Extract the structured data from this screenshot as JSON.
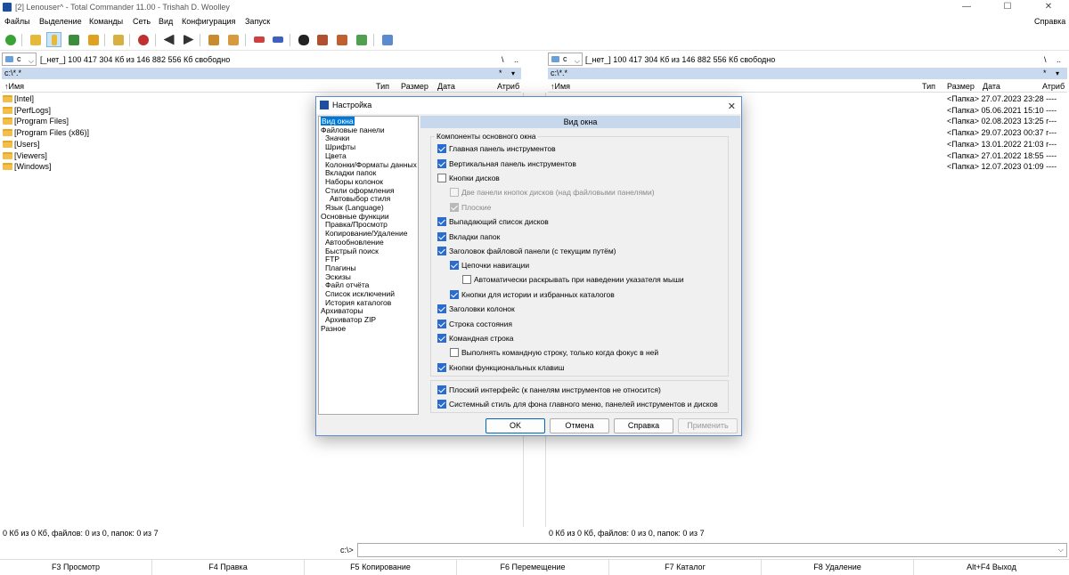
{
  "window": {
    "title": "[2] Lenouser^ - Total Commander 11.00 - Trishah D. Woolley",
    "minimize": "—",
    "maximize": "☐",
    "close": "✕"
  },
  "menu": {
    "items": [
      "Файлы",
      "Выделение",
      "Команды",
      "Сеть",
      "Вид",
      "Конфигурация",
      "Запуск"
    ],
    "help": "Справка"
  },
  "left_panel": {
    "drive": "c",
    "drive_info": "[_нет_]  100 417 304 Кб из 146 882 556 Кб свободно",
    "root_btn": "\\",
    "up_btn": "..",
    "path": "c:\\*.*",
    "path_star": "*",
    "columns": {
      "name": "↑Имя",
      "type": "Тип",
      "size": "Размер",
      "date": "Дата",
      "attr": "Атриб"
    },
    "files": [
      "[Intel]",
      "[PerfLogs]",
      "[Program Files]",
      "[Program Files (x86)]",
      "[Users]",
      "[Viewers]",
      "[Windows]"
    ],
    "status": "0 Кб из 0 Кб, файлов: 0 из 0, папок: 0 из 7"
  },
  "right_panel": {
    "drive": "c",
    "drive_info": "[_нет_]  100 417 304 Кб из 146 882 556 Кб свободно",
    "root_btn": "\\",
    "up_btn": "..",
    "path": "c:\\*.*",
    "path_star": "*",
    "columns": {
      "name": "↑Имя",
      "type": "Тип",
      "size": "Размер",
      "date": "Дата",
      "attr": "Атриб"
    },
    "rows": [
      {
        "size": "<Папка>",
        "date": "27.07.2023 23:28",
        "attr": "----"
      },
      {
        "size": "<Папка>",
        "date": "05.06.2021 15:10",
        "attr": "----"
      },
      {
        "size": "<Папка>",
        "date": "02.08.2023 13:25",
        "attr": "r---"
      },
      {
        "size": "<Папка>",
        "date": "29.07.2023 00:37",
        "attr": "r---"
      },
      {
        "size": "<Папка>",
        "date": "13.01.2022 21:03",
        "attr": "r---"
      },
      {
        "size": "<Папка>",
        "date": "27.01.2022 18:55",
        "attr": "----"
      },
      {
        "size": "<Папка>",
        "date": "12.07.2023 01:09",
        "attr": "----"
      }
    ],
    "status": "0 Кб из 0 Кб, файлов: 0 из 0, папок: 0 из 7"
  },
  "cmdline": {
    "prompt": "c:\\>"
  },
  "fkeys": [
    "F3 Просмотр",
    "F4 Правка",
    "F5 Копирование",
    "F6 Перемещение",
    "F7 Каталог",
    "F8 Удаление",
    "Alt+F4 Выход"
  ],
  "dialog": {
    "title": "Настройка",
    "close": "✕",
    "page_header": "Вид окна",
    "tree": [
      {
        "label": "Вид окна",
        "level": 0,
        "selected": true
      },
      {
        "label": "Файловые панели",
        "level": 0
      },
      {
        "label": "Значки",
        "level": 1
      },
      {
        "label": "Шрифты",
        "level": 1
      },
      {
        "label": "Цвета",
        "level": 1
      },
      {
        "label": "Колонки/Форматы данных",
        "level": 1
      },
      {
        "label": "Вкладки папок",
        "level": 1
      },
      {
        "label": "Наборы колонок",
        "level": 1
      },
      {
        "label": "Стили оформления",
        "level": 1
      },
      {
        "label": "Автовыбор стиля",
        "level": 2
      },
      {
        "label": "Язык (Language)",
        "level": 1
      },
      {
        "label": "Основные функции",
        "level": 0
      },
      {
        "label": "Правка/Просмотр",
        "level": 1
      },
      {
        "label": "Копирование/Удаление",
        "level": 1
      },
      {
        "label": "Автообновление",
        "level": 1
      },
      {
        "label": "Быстрый поиск",
        "level": 1
      },
      {
        "label": "FTP",
        "level": 1
      },
      {
        "label": "Плагины",
        "level": 1
      },
      {
        "label": "Эскизы",
        "level": 1
      },
      {
        "label": "Файл отчёта",
        "level": 1
      },
      {
        "label": "Список исключений",
        "level": 1
      },
      {
        "label": "История каталогов",
        "level": 1
      },
      {
        "label": "Архиваторы",
        "level": 0
      },
      {
        "label": "Архиватор ZIP",
        "level": 1
      },
      {
        "label": "Разное",
        "level": 0
      }
    ],
    "group_title": "Компоненты основного окна",
    "options": [
      {
        "label": "Главная панель инструментов",
        "checked": true,
        "indent": 0,
        "disabled": false
      },
      {
        "label": "Вертикальная панель инструментов",
        "checked": true,
        "indent": 0,
        "disabled": false
      },
      {
        "label": "Кнопки дисков",
        "checked": false,
        "indent": 0,
        "disabled": false
      },
      {
        "label": "Две панели кнопок дисков (над файловыми панелями)",
        "checked": false,
        "indent": 1,
        "disabled": true
      },
      {
        "label": "Плоские",
        "checked": true,
        "indent": 1,
        "disabled": true
      },
      {
        "label": "Выпадающий список дисков",
        "checked": true,
        "indent": 0,
        "disabled": false
      },
      {
        "label": "Вкладки папок",
        "checked": true,
        "indent": 0,
        "disabled": false
      },
      {
        "label": "Заголовок файловой панели (с текущим путём)",
        "checked": true,
        "indent": 0,
        "disabled": false
      },
      {
        "label": "Цепочки навигации",
        "checked": true,
        "indent": 1,
        "disabled": false
      },
      {
        "label": "Автоматически раскрывать при наведении указателя мыши",
        "checked": false,
        "indent": 2,
        "disabled": false
      },
      {
        "label": "Кнопки для истории и избранных каталогов",
        "checked": true,
        "indent": 1,
        "disabled": false
      },
      {
        "label": "Заголовки колонок",
        "checked": true,
        "indent": 0,
        "disabled": false
      },
      {
        "label": "Строка состояния",
        "checked": true,
        "indent": 0,
        "disabled": false
      },
      {
        "label": "Командная строка",
        "checked": true,
        "indent": 0,
        "disabled": false
      },
      {
        "label": "Выполнять командную строку, только когда фокус в ней",
        "checked": false,
        "indent": 1,
        "disabled": false
      },
      {
        "label": "Кнопки функциональных клавиш",
        "checked": true,
        "indent": 0,
        "disabled": false
      }
    ],
    "extra_options": [
      {
        "label": "Плоский интерфейс (к панелям инструментов не относится)",
        "checked": true
      },
      {
        "label": "Системный стиль для фона главного меню, панелей инструментов и дисков",
        "checked": true
      }
    ],
    "buttons": {
      "ok": "OK",
      "cancel": "Отмена",
      "help": "Справка",
      "apply": "Применить"
    }
  },
  "colors": {
    "accent": "#0078d7",
    "path_bar": "#c9d9ee",
    "folder": "#f2c04a"
  }
}
